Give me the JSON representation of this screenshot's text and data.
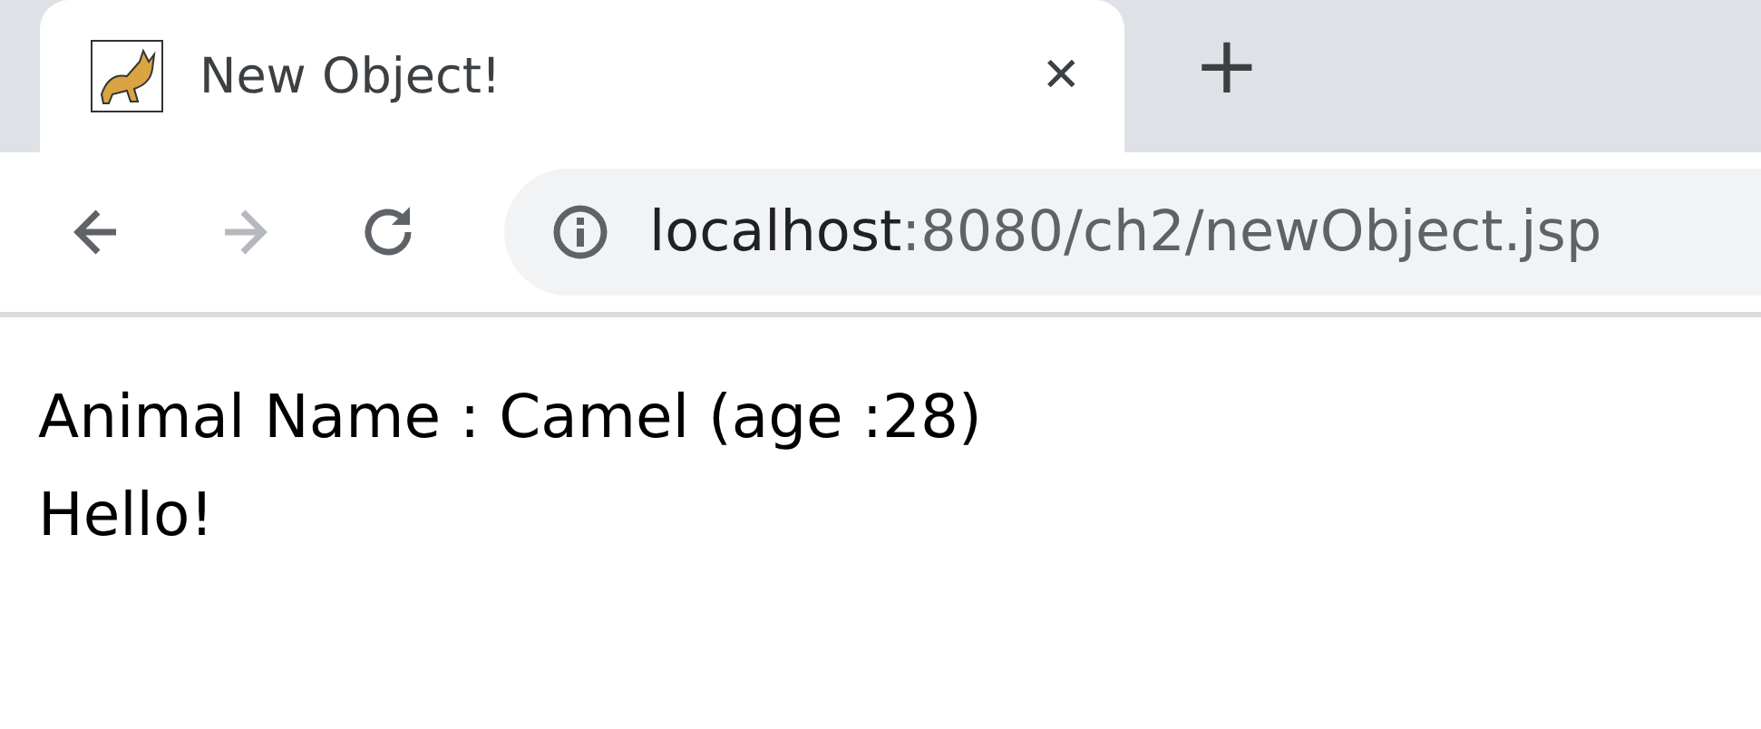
{
  "tab": {
    "title": "New Object!",
    "close": "✕",
    "new_tab": "+"
  },
  "toolbar": {
    "buttons": [
      {
        "kind": "back",
        "disabled": false
      },
      {
        "kind": "forward",
        "disabled": true
      },
      {
        "kind": "reload",
        "disabled": false
      }
    ],
    "address": {
      "host": "localhost",
      "path": ":8080/ch2/newObject.jsp"
    }
  },
  "content": {
    "lines": [
      "Animal Name : Camel (age :28)",
      "Hello!"
    ]
  }
}
